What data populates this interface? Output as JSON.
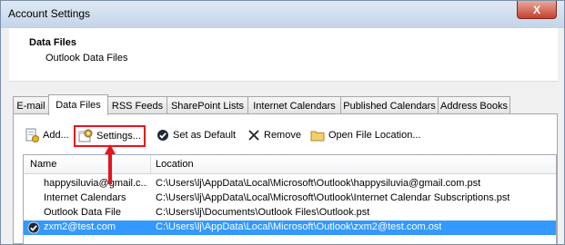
{
  "window": {
    "title": "Account Settings",
    "close_glyph": "X"
  },
  "header": {
    "title": "Data Files",
    "subtitle": "Outlook Data Files"
  },
  "tabs": [
    {
      "label": "E-mail"
    },
    {
      "label": "Data Files"
    },
    {
      "label": "RSS Feeds"
    },
    {
      "label": "SharePoint Lists"
    },
    {
      "label": "Internet Calendars"
    },
    {
      "label": "Published Calendars"
    },
    {
      "label": "Address Books"
    }
  ],
  "active_tab": "Data Files",
  "toolbar": {
    "add_label": "Add...",
    "settings_label": "Settings...",
    "set_default_label": "Set as Default",
    "remove_label": "Remove",
    "open_location_label": "Open File Location..."
  },
  "list": {
    "columns": [
      "Name",
      "Location"
    ],
    "rows": [
      {
        "name": "happysiluvia@gmail.c...",
        "location": "C:\\Users\\lj\\AppData\\Local\\Microsoft\\Outlook\\happysiluvia@gmail.com.pst",
        "default": false,
        "selected": false
      },
      {
        "name": "Internet Calendars",
        "location": "C:\\Users\\lj\\AppData\\Local\\Microsoft\\Outlook\\Internet Calendar Subscriptions.pst",
        "default": false,
        "selected": false
      },
      {
        "name": "Outlook Data File",
        "location": "C:\\Users\\lj\\Documents\\Outlook Files\\Outlook.pst",
        "default": false,
        "selected": false
      },
      {
        "name": "zxm2@test.com",
        "location": "C:\\Users\\lj\\AppData\\Local\\Microsoft\\Outlook\\zxm2@test.com.ost",
        "default": true,
        "selected": true
      }
    ]
  },
  "colors": {
    "highlight": "#e8131b",
    "selection": "#3399ff"
  },
  "icons": [
    "add-file-icon",
    "settings-icon",
    "default-check-icon",
    "remove-x-icon",
    "folder-icon",
    "red-arrow-annotation"
  ]
}
